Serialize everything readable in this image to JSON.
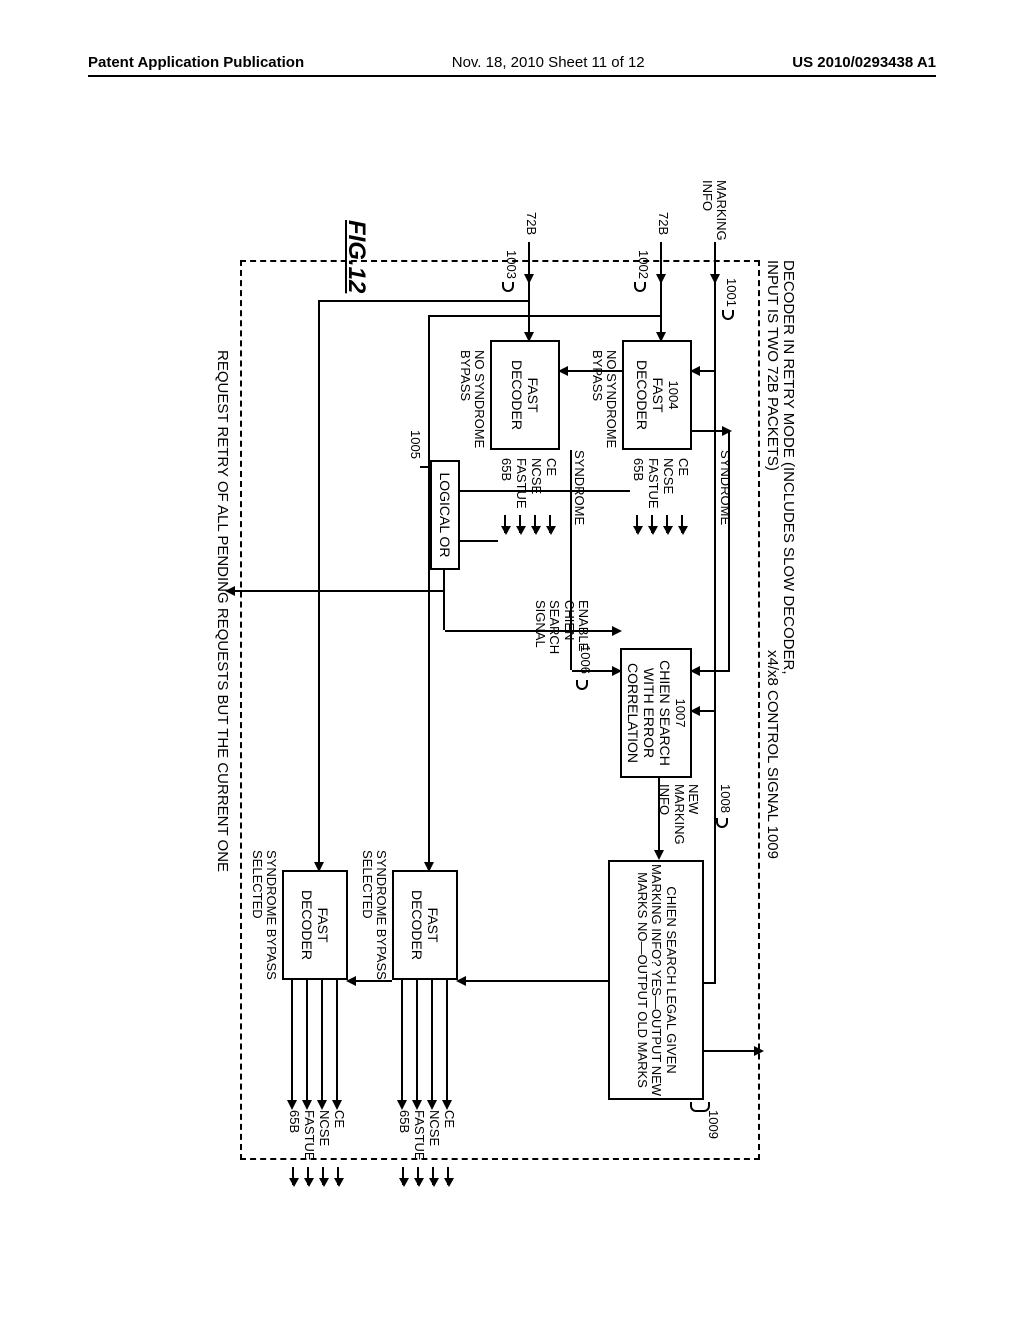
{
  "header": {
    "left": "Patent Application Publication",
    "center": "Nov. 18, 2010  Sheet 11 of 12",
    "right": "US 2010/0293438 A1"
  },
  "title_line1": "DECODER IN RETRY MODE (INCLUDES SLOW DECODER,",
  "title_line2": "INPUT IS TWO 72B PACKETS)",
  "control_sig": "x4/x8 CONTROL SIGNAL 1009",
  "marking_info_in": "MARKING\nINFO",
  "ref_1001": "1001",
  "ref_1002": "1002",
  "ref_1003": "1003",
  "ref_1004": "1004",
  "ref_1005": "1005",
  "ref_1006": "1006",
  "ref_1007": "1007",
  "ref_1008": "1008",
  "ref_1009": "1009",
  "in_72b": "72B",
  "fast_decoder": "FAST\nDECODER",
  "no_syndrome_bypass": "NO SYNDROME\nBYPASS",
  "syndrome": "SYNDROME",
  "sig_ce": "CE",
  "sig_ncse": "NCSE",
  "sig_fastue": "FASTUE",
  "sig_65b": "65B",
  "logical_or": "LOGICAL OR",
  "enable_chien": "ENABLE\nCHIEN\nSEARCH\nSIGNAL",
  "chien_corr": "CHIEN\nSEARCH\nWITH ERROR\nCORRELATION",
  "new_marking_info": "NEW\nMARKING\nINFO",
  "chien_legal": "CHIEN SEARCH\nLEGAL GIVEN\nMARKING INFO?\nYES—OUTPUT NEW MARKS\nNO—OUTPUT OLD MARKS",
  "syndrome_bypass_selected": "SYNDROME BYPASS\nSELECTED",
  "fig": "FIG.12",
  "request_retry": "REQUEST RETRY OF ALL PENDING REQUESTS BUT THE CURRENT ONE"
}
